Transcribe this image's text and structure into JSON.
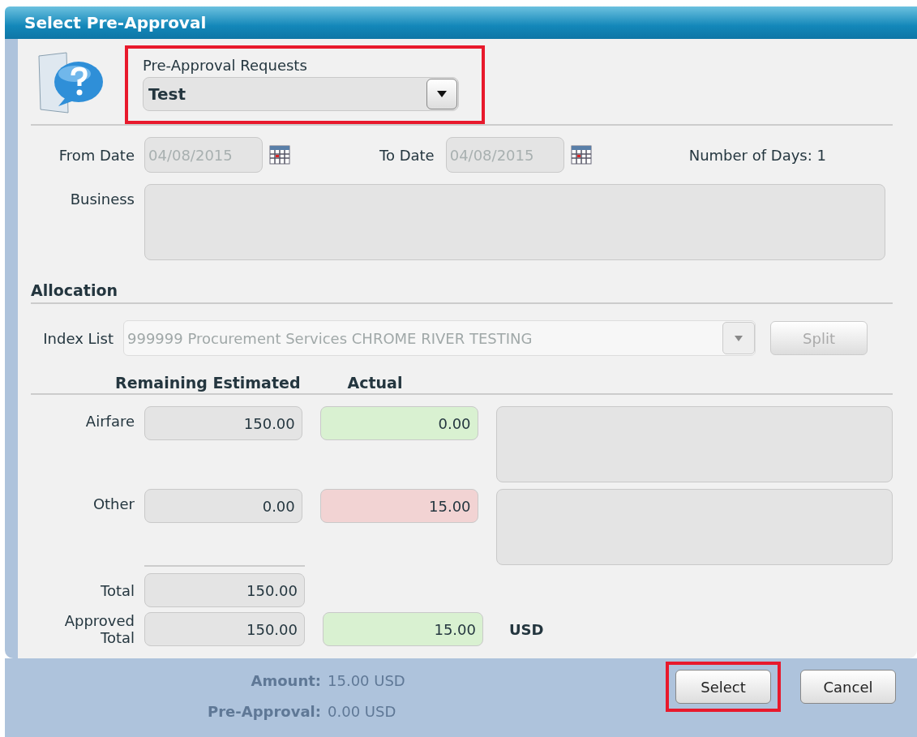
{
  "window": {
    "title": "Select Pre-Approval"
  },
  "request": {
    "label": "Pre-Approval Requests",
    "value": "Test",
    "highlighted": true
  },
  "dates": {
    "from_label": "From Date",
    "from_value": "04/08/2015",
    "to_label": "To Date",
    "to_value": "04/08/2015",
    "days_label": "Number of Days:",
    "days_value": "1"
  },
  "business": {
    "label": "Business"
  },
  "allocation": {
    "heading": "Allocation",
    "index_label": "Index List",
    "index_value": "999999  Procurement Services  CHROME RIVER TESTING",
    "split_button": "Split",
    "split_disabled": true
  },
  "columns": [
    "Remaining Estimated",
    "Actual"
  ],
  "rows": [
    {
      "label": "Airfare",
      "estimated": "150.00",
      "actual": "0.00",
      "color": "#d9f1d1"
    },
    {
      "label": "Other",
      "estimated": "0.00",
      "actual": "15.00",
      "color": "#f2d3d3"
    }
  ],
  "total": {
    "label": "Total",
    "estimated": "150.00"
  },
  "approved_total": {
    "label": "Approved Total",
    "estimated": "150.00",
    "actual": "15.00",
    "color": "#d9f1d1",
    "currency": "USD"
  },
  "background": [
    {
      "label": "Amount:",
      "value": "15.00 USD"
    },
    {
      "label": "Pre-Approval:",
      "value": "0.00 USD"
    }
  ],
  "buttons": [
    {
      "label": "Select",
      "highlighted": true
    },
    {
      "label": "Cancel",
      "highlighted": false
    }
  ]
}
